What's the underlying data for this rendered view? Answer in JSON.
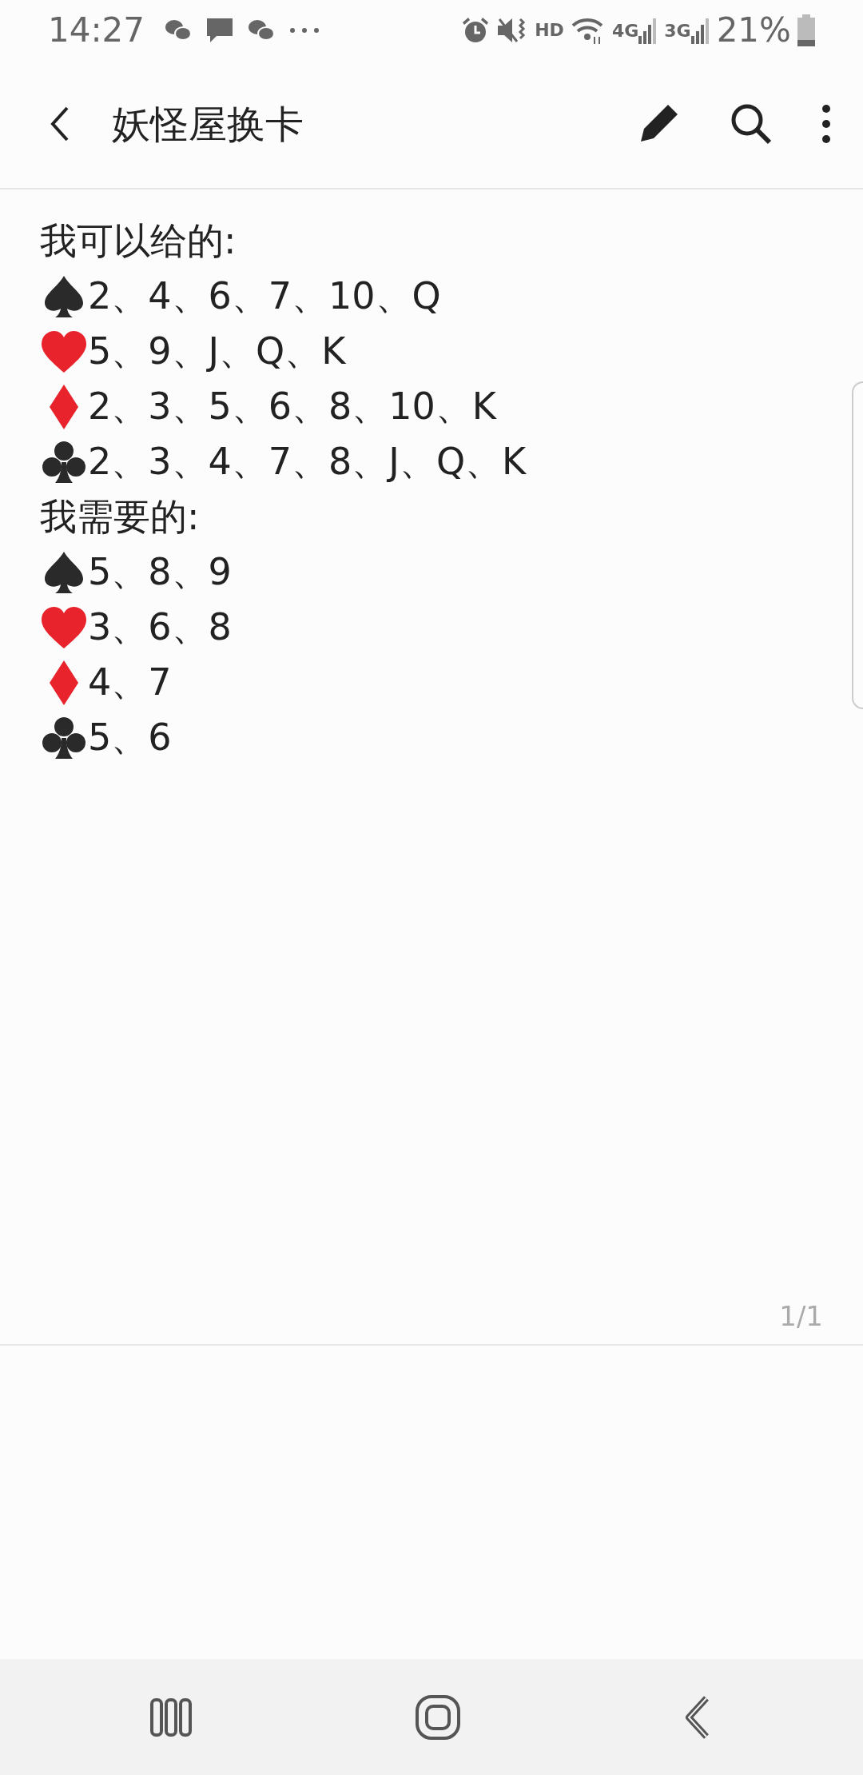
{
  "status_bar": {
    "time": "14:27",
    "hd": "HD",
    "net1": "4G",
    "net2": "3G",
    "battery": "21%"
  },
  "app_bar": {
    "title": "妖怪屋换卡"
  },
  "note": {
    "lines": [
      {
        "kind": "heading",
        "text": "我可以给的:"
      },
      {
        "kind": "spade",
        "text": "2、4、6、7、10、Q"
      },
      {
        "kind": "heart",
        "text": "5、9、J、Q、K"
      },
      {
        "kind": "diamond",
        "text": "2、3、5、6、8、10、K"
      },
      {
        "kind": "club",
        "text": "2、3、4、7、8、J、Q、K"
      },
      {
        "kind": "heading",
        "text": "我需要的:"
      },
      {
        "kind": "spade",
        "text": "5、8、9"
      },
      {
        "kind": "heart",
        "text": "3、6、8"
      },
      {
        "kind": "diamond",
        "text": "4、7"
      },
      {
        "kind": "club",
        "text": "5、6"
      }
    ],
    "page": "1/1"
  }
}
